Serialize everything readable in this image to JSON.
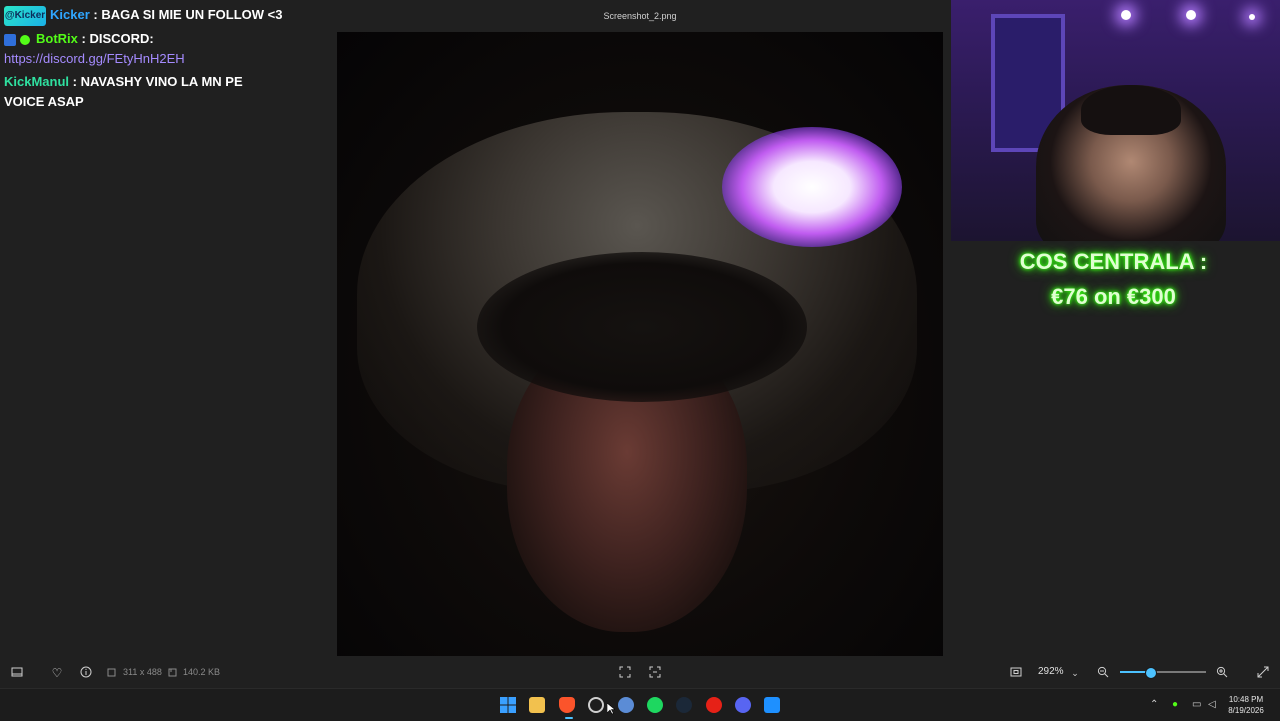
{
  "window": {
    "title": "Screenshot_2.png"
  },
  "chat": {
    "messages": [
      {
        "badge": "@Kicker",
        "user": "Kicker",
        "text": ": BAGA SI MIE UN FOLLOW <3",
        "user_color": "#2fa6ff"
      },
      {
        "user": "BotRix",
        "text": ": DISCORD:",
        "link": "https://discord.gg/FEtyHnH2EH",
        "user_color": "#53fc18"
      },
      {
        "user": "KickManul",
        "text": ": NAVASHY VINO LA MN PE",
        "text2": "VOICE ASAP",
        "user_color": "#2fe0a0"
      }
    ]
  },
  "overlay": {
    "goal_line1": "COS CENTRALA :",
    "goal_line2": "€76 on €300"
  },
  "image_info": {
    "dimensions": "311 x 488",
    "size": "140.2 KB"
  },
  "toolbar": {
    "zoom": "292%",
    "zoom_level": 0.35
  },
  "taskbar": {
    "time": "10:48 PM",
    "date": "8/19/2026",
    "apps": [
      "start-icon",
      "file-explorer-icon",
      "brave-icon",
      "obs-icon",
      "app-icon",
      "spotify-icon",
      "steam-icon",
      "youtube-icon",
      "discord-icon",
      "app-store-icon"
    ]
  },
  "colors": {
    "accent": "#4cc2ff",
    "goal_glow": "#39ff14",
    "link": "#a58bff"
  }
}
